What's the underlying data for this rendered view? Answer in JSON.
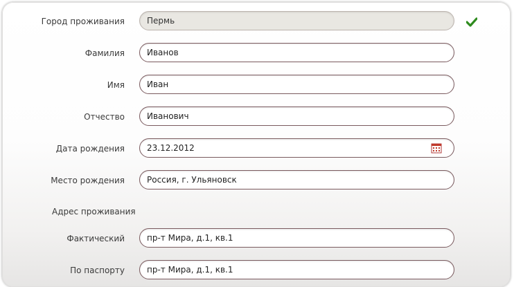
{
  "form": {
    "city": {
      "label": "Город проживания",
      "value": "Пермь"
    },
    "last_name": {
      "label": "Фамилия",
      "value": "Иванов"
    },
    "first_name": {
      "label": "Имя",
      "value": "Иван"
    },
    "patronymic": {
      "label": "Отчество",
      "value": "Иванович"
    },
    "birth_date": {
      "label": "Дата рождения",
      "value": "23.12.2012"
    },
    "birth_place": {
      "label": "Место рождения",
      "value": "Россия, г. Ульяновск"
    },
    "address_section": "Адрес проживания",
    "actual_address": {
      "label": "Фактический",
      "value": "пр-т Мира, д.1, кв.1"
    },
    "passport_address": {
      "label": "По паспорту",
      "value": "пр-т Мира, д.1, кв.1"
    }
  },
  "icons": {
    "check": "check-icon",
    "calendar": "calendar-icon"
  },
  "colors": {
    "check_green": "#2e8b1e",
    "field_border": "#7a5a5e",
    "readonly_bg": "#e9e7e2"
  }
}
